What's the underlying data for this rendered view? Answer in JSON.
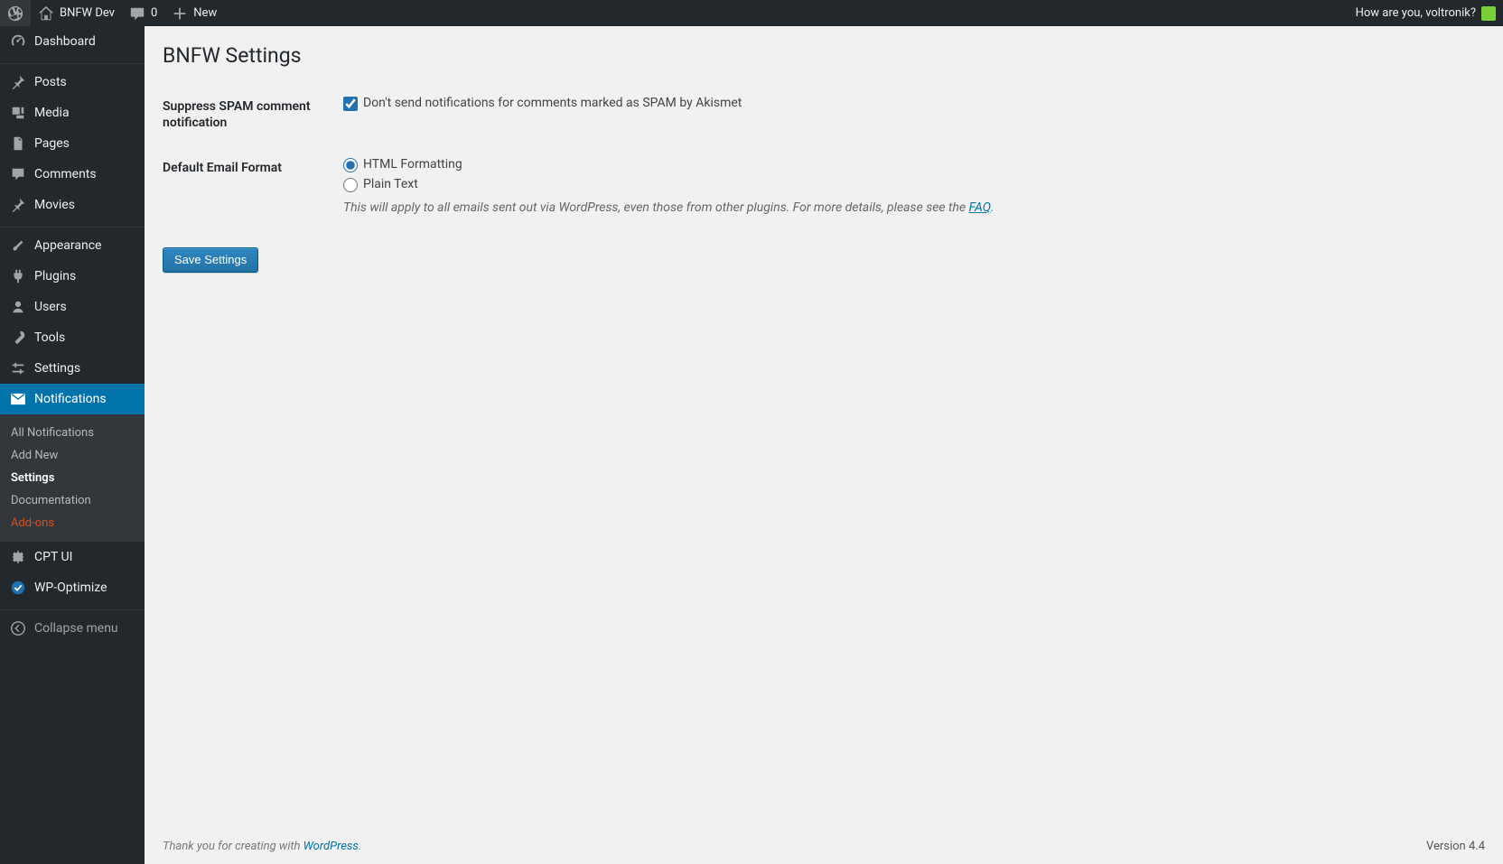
{
  "adminbar": {
    "site_name": "BNFW Dev",
    "comments_count": "0",
    "new_label": "New",
    "howdy_prefix": "How are you, ",
    "howdy_user": "voltronik",
    "howdy_suffix": "?"
  },
  "adminmenu": {
    "dashboard": "Dashboard",
    "posts": "Posts",
    "media": "Media",
    "pages": "Pages",
    "comments": "Comments",
    "movies": "Movies",
    "appearance": "Appearance",
    "plugins": "Plugins",
    "users": "Users",
    "tools": "Tools",
    "settings": "Settings",
    "notifications": "Notifications",
    "cpt_ui": "CPT UI",
    "wp_optimize": "WP-Optimize",
    "collapse": "Collapse menu"
  },
  "submenu": {
    "all_notifications": "All Notifications",
    "add_new": "Add New",
    "settings": "Settings",
    "documentation": "Documentation",
    "addons": "Add-ons"
  },
  "page": {
    "title": "BNFW Settings",
    "row1_label": "Suppress SPAM comment notification",
    "row1_checkbox_label": "Don't send notifications for comments marked as SPAM by Akismet",
    "row2_label": "Default Email Format",
    "row2_opt1": "HTML Formatting",
    "row2_opt2": "Plain Text",
    "row2_desc_pre": "This will apply to all emails sent out via WordPress, even those from other plugins. For more details, please see the ",
    "row2_desc_link": "FAQ",
    "row2_desc_post": ".",
    "save_button": "Save Settings"
  },
  "footer": {
    "thanks_pre": "Thank you for creating with ",
    "thanks_link": "WordPress",
    "thanks_post": ".",
    "version": "Version 4.4"
  }
}
